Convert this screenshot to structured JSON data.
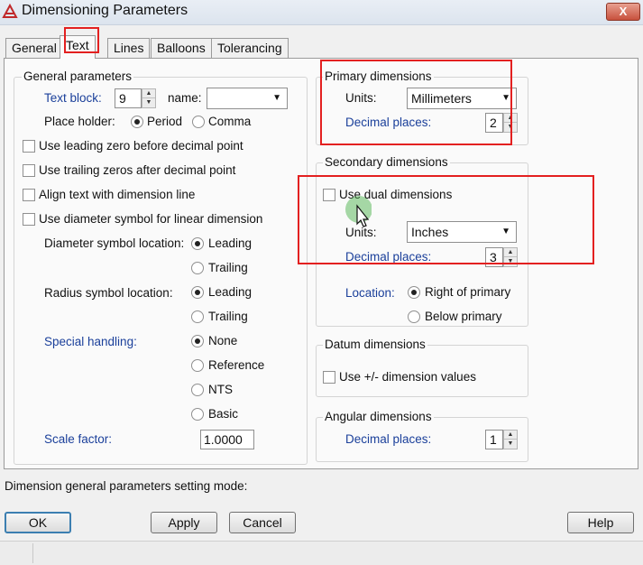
{
  "window": {
    "title": "Dimensioning Parameters",
    "close_symbol": "X"
  },
  "tabs": [
    {
      "label": "General",
      "active": false
    },
    {
      "label": "Text",
      "active": true
    },
    {
      "label": "Lines",
      "active": false
    },
    {
      "label": "Balloons",
      "active": false
    },
    {
      "label": "Tolerancing",
      "active": false
    }
  ],
  "general": {
    "group_label": "General parameters",
    "text_block": {
      "label": "Text block:",
      "value": "9"
    },
    "name": {
      "label": "name:",
      "value": ""
    },
    "place_holder": {
      "label": "Place holder:",
      "options": [
        "Period",
        "Comma"
      ],
      "selected": "Period"
    },
    "checkboxes": [
      {
        "label": "Use leading zero before decimal point",
        "checked": false
      },
      {
        "label": "Use trailing zeros after decimal point",
        "checked": false
      },
      {
        "label": "Align text with dimension line",
        "checked": false
      },
      {
        "label": "Use diameter symbol for linear dimension",
        "checked": false
      }
    ],
    "diameter_symbol_location": {
      "label": "Diameter symbol location:",
      "options": [
        "Leading",
        "Trailing"
      ],
      "selected": "Leading"
    },
    "radius_symbol_location": {
      "label": "Radius symbol location:",
      "options": [
        "Leading",
        "Trailing"
      ],
      "selected": "Leading"
    },
    "special_handling": {
      "label": "Special handling:",
      "options": [
        "None",
        "Reference",
        "NTS",
        "Basic"
      ],
      "selected": "None"
    },
    "scale_factor": {
      "label": "Scale factor:",
      "value": "1.0000"
    }
  },
  "primary": {
    "group_label": "Primary dimensions",
    "units": {
      "label": "Units:",
      "value": "Millimeters"
    },
    "decimal_places": {
      "label": "Decimal places:",
      "value": "2"
    }
  },
  "secondary": {
    "group_label": "Secondary dimensions",
    "use_dual": {
      "label": "Use dual dimensions",
      "checked": false
    },
    "units": {
      "label": "Units:",
      "value": "Inches"
    },
    "decimal_places": {
      "label": "Decimal places:",
      "value": "3"
    },
    "location": {
      "label": "Location:",
      "options": [
        "Right of primary",
        "Below primary"
      ],
      "selected": "Right of primary"
    }
  },
  "datum": {
    "group_label": "Datum dimensions",
    "use_plus_minus": {
      "label": "Use +/- dimension values",
      "checked": false
    }
  },
  "angular": {
    "group_label": "Angular dimensions",
    "decimal_places": {
      "label": "Decimal places:",
      "value": "1"
    }
  },
  "status_text": "Dimension general parameters setting mode:",
  "buttons": {
    "ok": "OK",
    "apply": "Apply",
    "cancel": "Cancel",
    "help": "Help"
  },
  "colors": {
    "label_blue": "#1a3f9a",
    "highlight_red": "#e32020",
    "default_button_border": "#3c7fb1"
  }
}
